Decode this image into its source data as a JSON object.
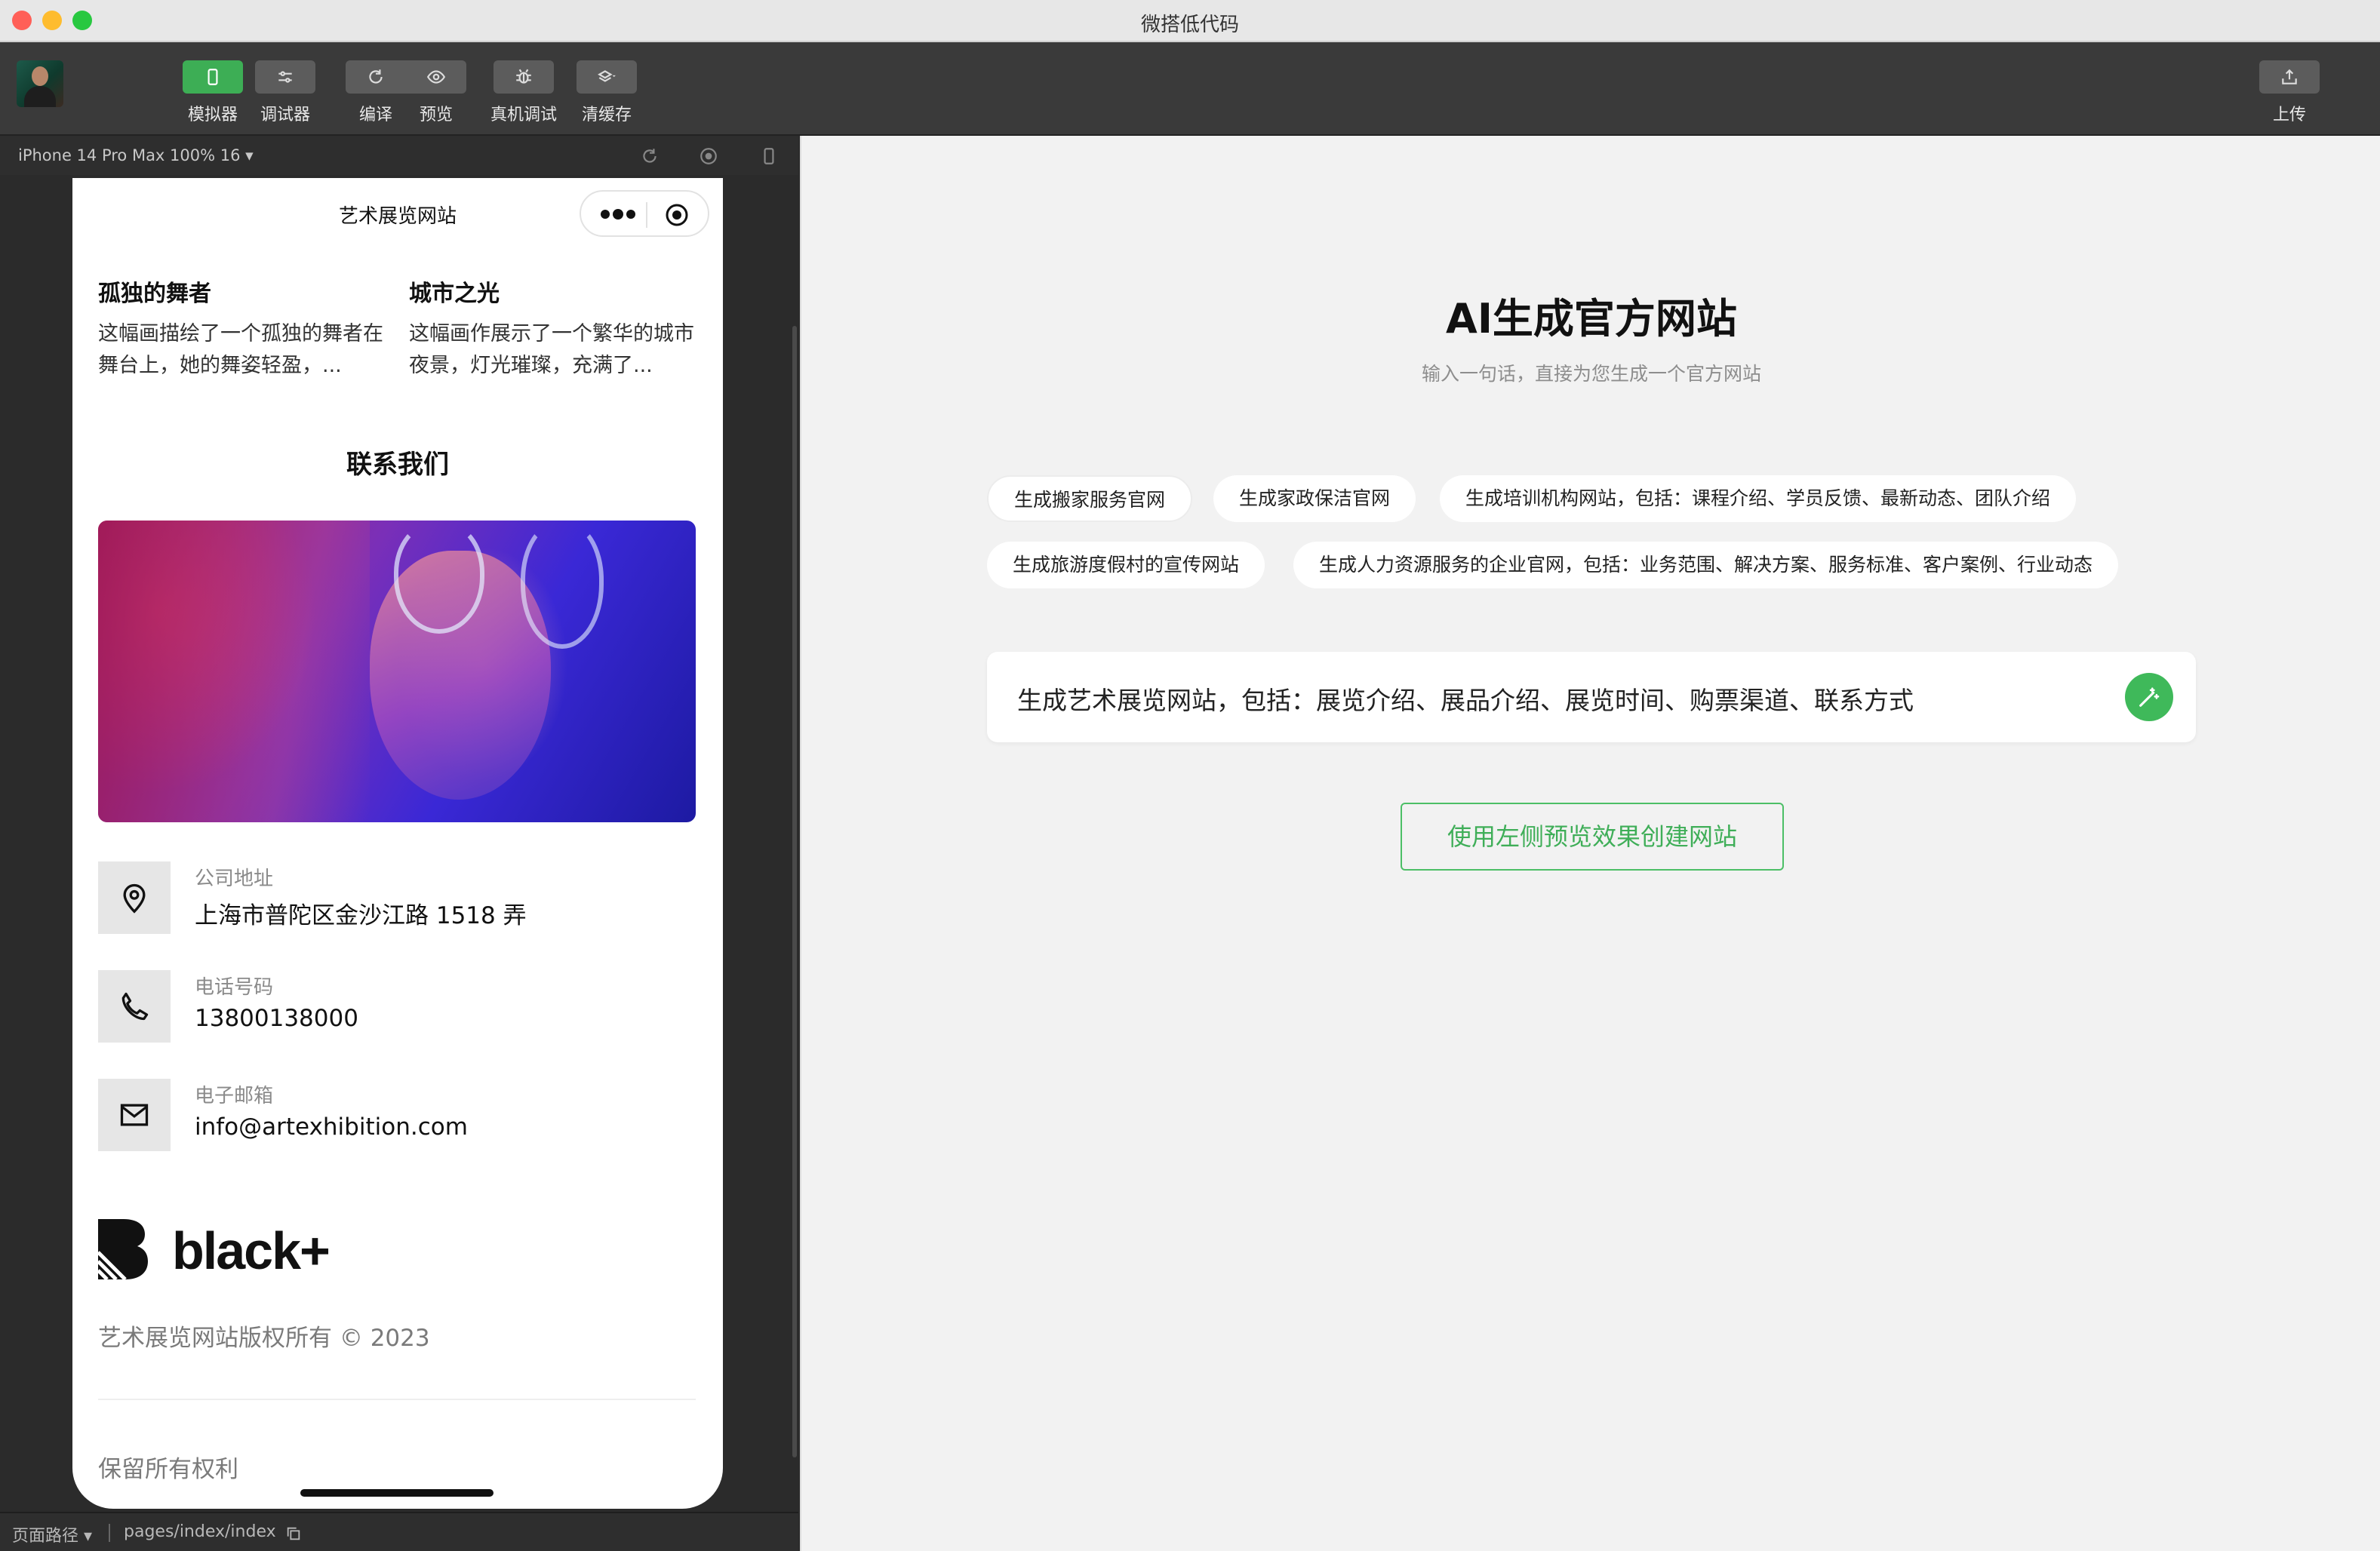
{
  "window": {
    "title": "微搭低代码"
  },
  "toolbar": {
    "simulator": "模拟器",
    "debugger": "调试器",
    "compile": "编译",
    "preview": "预览",
    "device_debug": "真机调试",
    "clear_cache": "清缓存",
    "upload": "上传"
  },
  "simulator": {
    "device": "iPhone 14 Pro Max 100% 16 ▾"
  },
  "phone": {
    "nav_title": "艺术展览网站",
    "artworks": [
      {
        "title": "孤独的舞者",
        "desc": "这幅画描绘了一个孤独的舞者在舞台上，她的舞姿轻盈，..."
      },
      {
        "title": "城市之光",
        "desc": "这幅画作展示了一个繁华的城市夜景，灯光璀璨，充满了..."
      }
    ],
    "contact_title": "联系我们",
    "contacts": [
      {
        "label": "公司地址",
        "value": "上海市普陀区金沙江路 1518 弄",
        "icon": "location-pin-icon"
      },
      {
        "label": "电话号码",
        "value": "13800138000",
        "icon": "phone-icon"
      },
      {
        "label": "电子邮箱",
        "value": "info@artexhibition.com",
        "icon": "mail-icon"
      }
    ],
    "brand": "black+",
    "copyright": "艺术展览网站版权所有 © 2023",
    "rights": "保留所有权利"
  },
  "statusbar": {
    "path_label": "页面路径 ▾",
    "path": "pages/index/index"
  },
  "ai": {
    "title": "AI生成官方网站",
    "subtitle": "输入一句话，直接为您生成一个官方网站",
    "suggestions": [
      "生成搬家服务官网",
      "生成家政保洁官网",
      "生成培训机构网站，包括：课程介绍、学员反馈、最新动态、团队介绍",
      "生成旅游度假村的宣传网站",
      "生成人力资源服务的企业官网，包括：业务范围、解决方案、服务标准、客户案例、行业动态"
    ],
    "prompt": "生成艺术展览网站，包括：展览介绍、展品介绍、展览时间、购票渠道、联系方式",
    "create_button": "使用左侧预览效果创建网站"
  },
  "colors": {
    "accent": "#3fb95a",
    "toolbar": "#3a3a3a",
    "panel": "#f2f2f2"
  }
}
